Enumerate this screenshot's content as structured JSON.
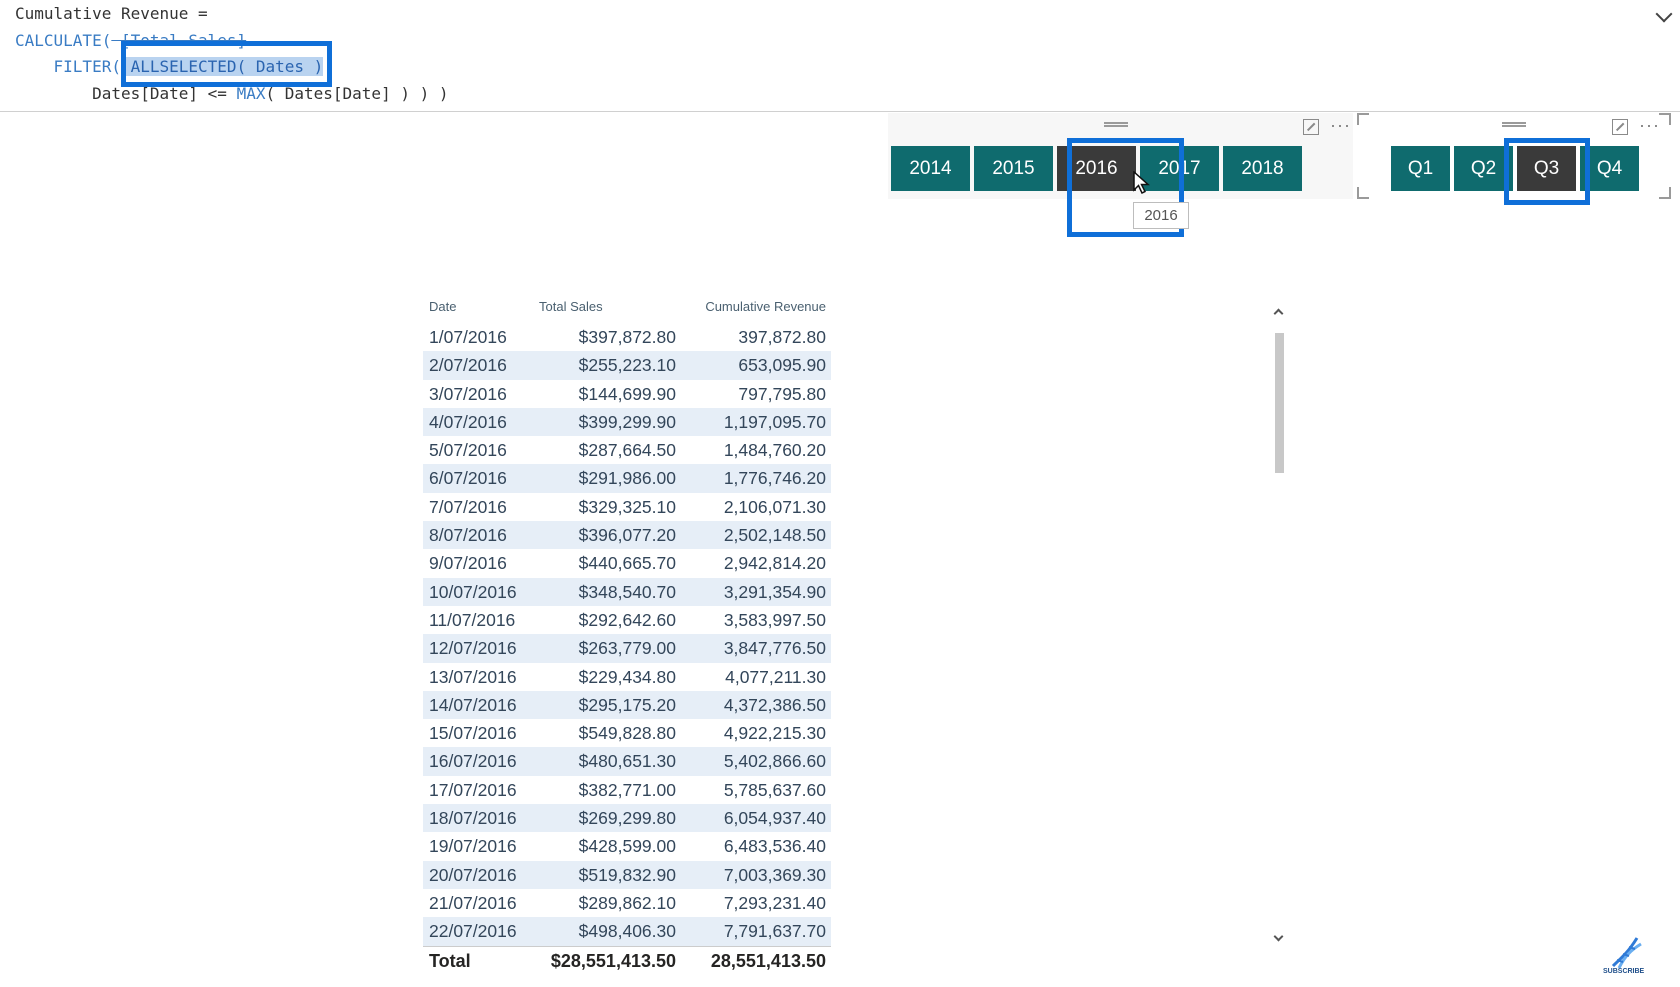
{
  "formula": {
    "line1": "Cumulative Revenue =",
    "line2_func": "CALCULATE(",
    "line2_arg": " [Total Sales]",
    "line3_func": "FILTER(",
    "line3_sel": " ALLSELECTED( Dates )",
    "line4_a": "Dates[Date] <= ",
    "line4_max": "MAX",
    "line4_b": "( Dates[Date] ) ) )"
  },
  "year_slicer": {
    "items": [
      "2014",
      "2015",
      "2016",
      "2017",
      "2018"
    ],
    "selected": "2016",
    "tooltip": "2016"
  },
  "quarter_slicer": {
    "items": [
      "Q1",
      "Q2",
      "Q3",
      "Q4"
    ],
    "selected": "Q3"
  },
  "table": {
    "headers": [
      "Date",
      "Total Sales",
      "Cumulative Revenue"
    ],
    "rows": [
      [
        "1/07/2016",
        "$397,872.80",
        "397,872.80"
      ],
      [
        "2/07/2016",
        "$255,223.10",
        "653,095.90"
      ],
      [
        "3/07/2016",
        "$144,699.90",
        "797,795.80"
      ],
      [
        "4/07/2016",
        "$399,299.90",
        "1,197,095.70"
      ],
      [
        "5/07/2016",
        "$287,664.50",
        "1,484,760.20"
      ],
      [
        "6/07/2016",
        "$291,986.00",
        "1,776,746.20"
      ],
      [
        "7/07/2016",
        "$329,325.10",
        "2,106,071.30"
      ],
      [
        "8/07/2016",
        "$396,077.20",
        "2,502,148.50"
      ],
      [
        "9/07/2016",
        "$440,665.70",
        "2,942,814.20"
      ],
      [
        "10/07/2016",
        "$348,540.70",
        "3,291,354.90"
      ],
      [
        "11/07/2016",
        "$292,642.60",
        "3,583,997.50"
      ],
      [
        "12/07/2016",
        "$263,779.00",
        "3,847,776.50"
      ],
      [
        "13/07/2016",
        "$229,434.80",
        "4,077,211.30"
      ],
      [
        "14/07/2016",
        "$295,175.20",
        "4,372,386.50"
      ],
      [
        "15/07/2016",
        "$549,828.80",
        "4,922,215.30"
      ],
      [
        "16/07/2016",
        "$480,651.30",
        "5,402,866.60"
      ],
      [
        "17/07/2016",
        "$382,771.00",
        "5,785,637.60"
      ],
      [
        "18/07/2016",
        "$269,299.80",
        "6,054,937.40"
      ],
      [
        "19/07/2016",
        "$428,599.00",
        "6,483,536.40"
      ],
      [
        "20/07/2016",
        "$519,832.90",
        "7,003,369.30"
      ],
      [
        "21/07/2016",
        "$289,862.10",
        "7,293,231.40"
      ],
      [
        "22/07/2016",
        "$498,406.30",
        "7,791,637.70"
      ]
    ],
    "total": [
      "Total",
      "$28,551,413.50",
      "28,551,413.50"
    ]
  },
  "colors": {
    "slicer_button": "#0f6b6e",
    "slicer_selected": "#3a3a3a",
    "highlight_box": "#0f6fd8",
    "row_alt": "#e6eef7"
  },
  "logo": {
    "label": "SUBSCRIBE"
  }
}
